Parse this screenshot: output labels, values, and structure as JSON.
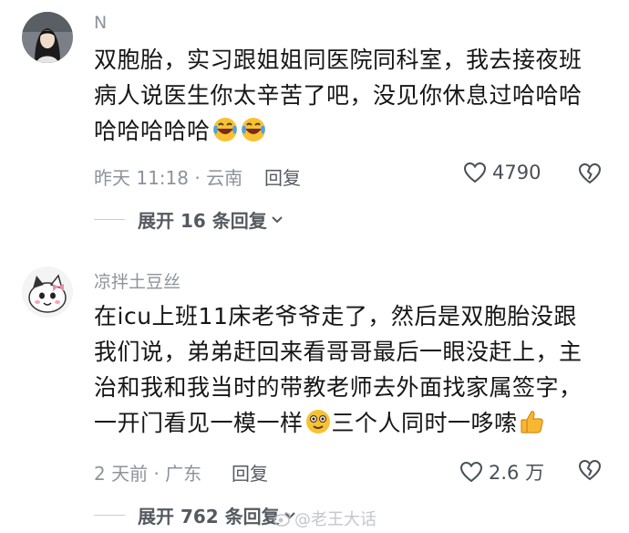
{
  "comments": [
    {
      "username": "N",
      "content": "双胞胎，实习跟姐姐同医院同科室，我去接夜班病人说医生你太辛苦了吧，没见你休息过哈哈哈哈哈哈哈哈",
      "emojis": [
        "laughing-crying-emoji",
        "laughing-crying-emoji"
      ],
      "time_location": "昨天 11:18 · 云南",
      "reply_label": "回复",
      "like_count": "4790",
      "expand_label": "展开 16 条回复"
    },
    {
      "username": "凉拌土豆丝",
      "content": "在icu上班11床老爷爷走了，然后是双胞胎没跟我们说，弟弟赶回来看哥哥最后一眼没赶上，主治和我和我当时的带教老师去外面找家属签字，一开门看见一模一样",
      "content_tail": "三个人同时一哆嗦",
      "emojis": [
        "shocked-emoji",
        "thumbs-up-emoji"
      ],
      "time_location": "2 天前 · 广东",
      "reply_label": "回复",
      "like_count": "2.6 万",
      "expand_label": "展开 762 条回复"
    }
  ],
  "watermark": "@老王大话"
}
